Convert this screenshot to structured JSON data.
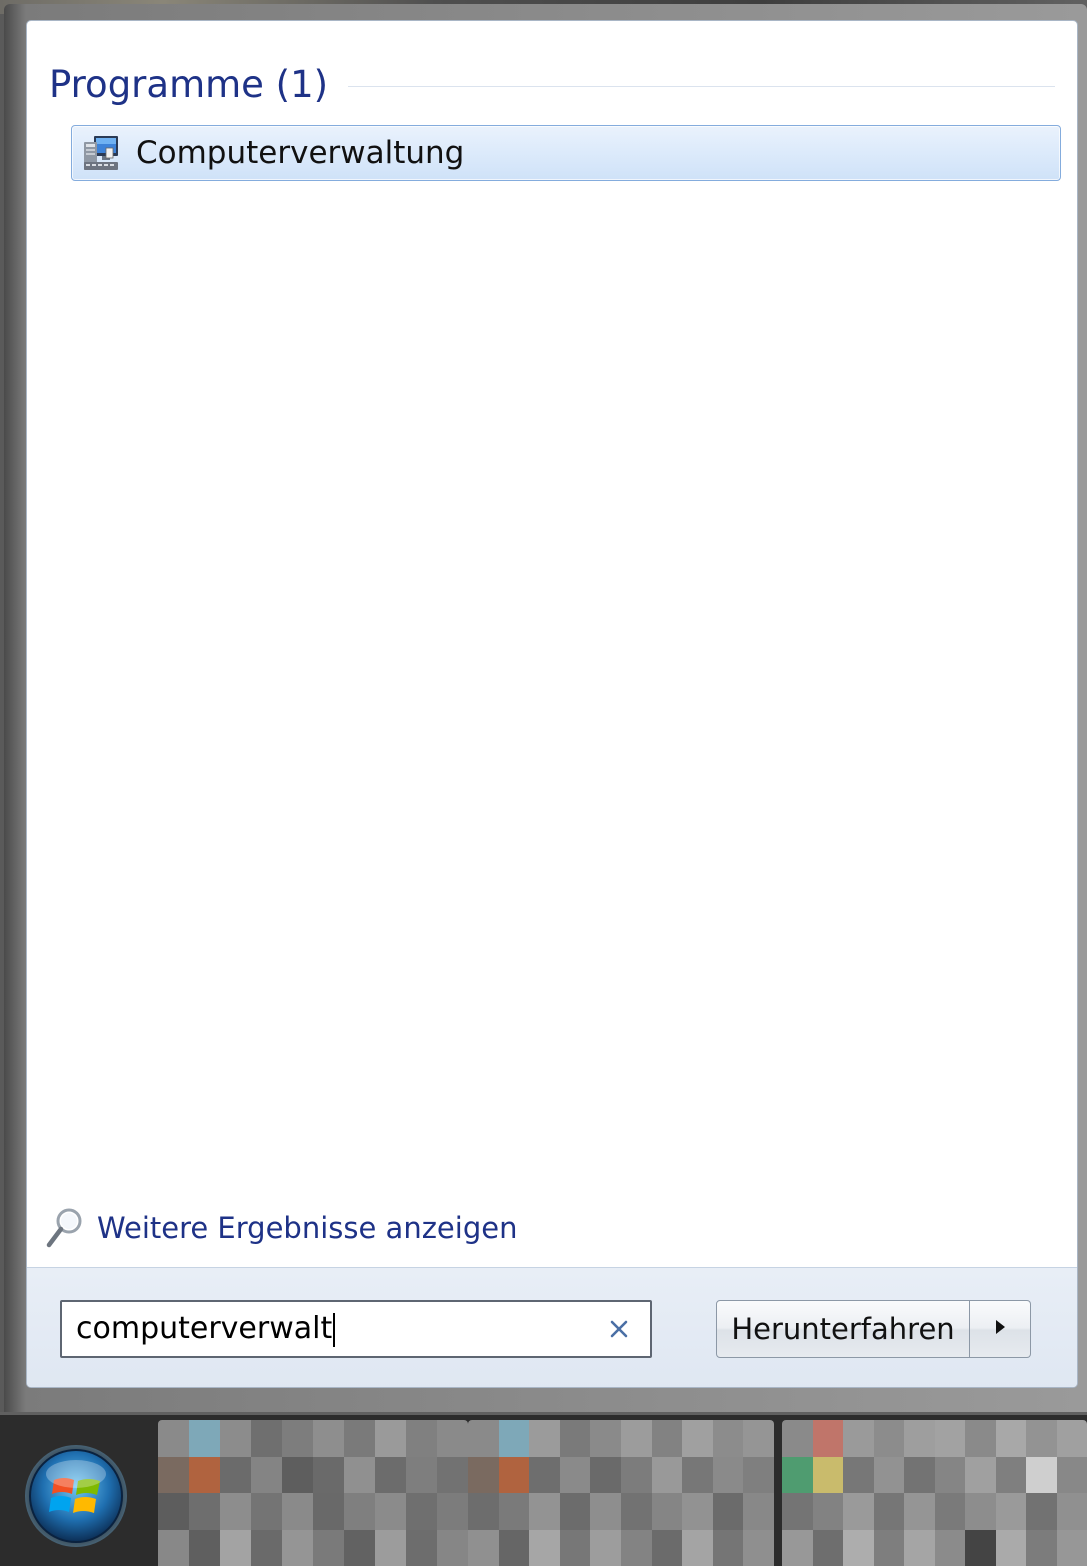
{
  "start_menu": {
    "section_title": "Programme (1)",
    "results": [
      {
        "label": "Computerverwaltung",
        "icon": "computer-management-icon",
        "selected": true
      }
    ],
    "more_results_label": "Weitere Ergebnisse anzeigen",
    "search": {
      "value": "computerverwalt",
      "clear_icon": "clear-x-icon"
    },
    "shutdown": {
      "label": "Herunterfahren",
      "arrow_icon": "triangle-right-icon"
    }
  },
  "taskbar": {
    "start_button_icon": "windows-start-orb-icon"
  },
  "colors": {
    "heading_blue": "#1e3287",
    "selection_border": "#84acdd",
    "selection_fill": "#dceafb"
  }
}
